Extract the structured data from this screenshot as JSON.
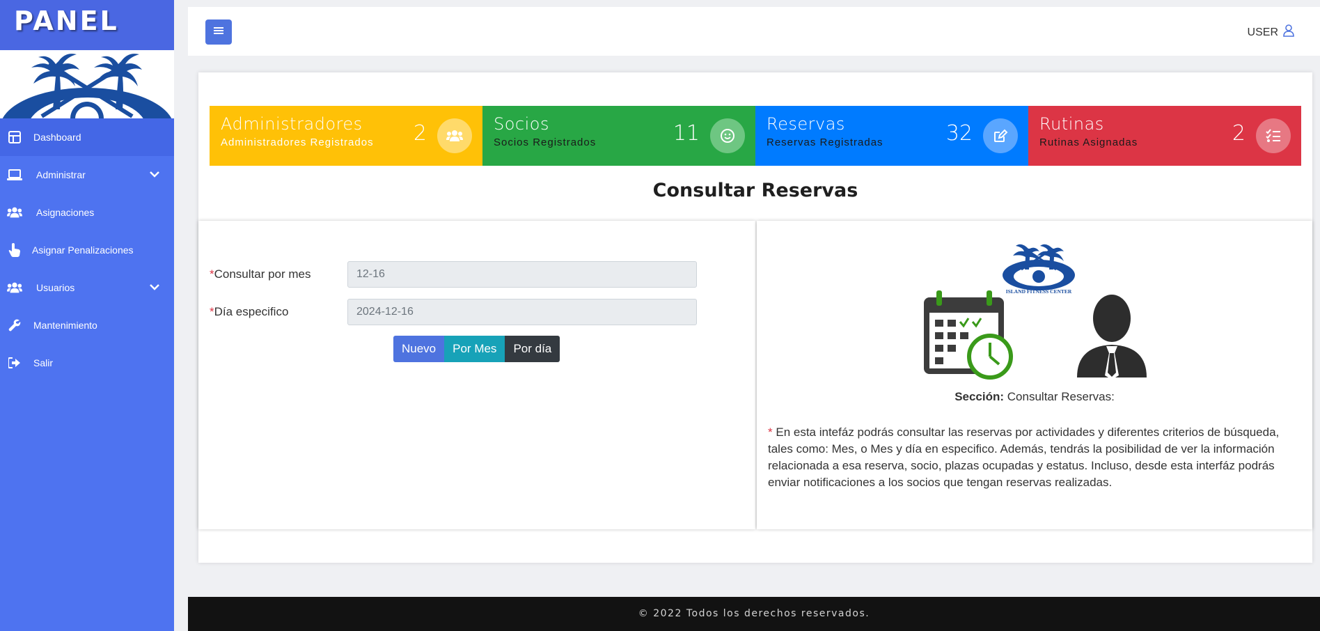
{
  "brand": {
    "title": "PANEL"
  },
  "sidebar": {
    "items": [
      {
        "label": "Dashboard",
        "icon": "dashboard-icon"
      },
      {
        "label": "Administrar",
        "icon": "laptop-icon"
      },
      {
        "label": "Asignaciones",
        "icon": "users-icon"
      },
      {
        "label": "Asignar Penalizaciones",
        "icon": "hand-pointer-icon"
      },
      {
        "label": "Usuarios",
        "icon": "users-icon"
      },
      {
        "label": "Mantenimiento",
        "icon": "wrench-icon"
      },
      {
        "label": "Salir",
        "icon": "sign-out-icon"
      }
    ]
  },
  "topbar": {
    "user_label": "USER"
  },
  "stats": [
    {
      "title": "Administradores",
      "subtitle": "Administradores Registrados",
      "count": "2",
      "color": "#ffc107",
      "icon": "users-icon"
    },
    {
      "title": "Socios",
      "subtitle": "Socios Registrados",
      "count": "11",
      "color": "#28a745",
      "icon": "smile-icon"
    },
    {
      "title": "Reservas",
      "subtitle": "Reservas Registradas",
      "count": "32",
      "color": "#007bff",
      "icon": "edit-icon"
    },
    {
      "title": "Rutinas",
      "subtitle": "Rutinas Asignadas",
      "count": "2",
      "color": "#dc3545",
      "icon": "list-check-icon"
    }
  ],
  "page_title": "Consultar Reservas",
  "form": {
    "month_label": "Consultar por mes",
    "month_value": "12-16",
    "day_label": "Día especifico",
    "day_value": "2024-12-16",
    "required_mark": "*",
    "buttons": {
      "nuevo": "Nuevo",
      "por_mes": "Por Mes",
      "por_dia": "Por día"
    }
  },
  "info": {
    "logo_text": "ISLAND FITNESS CENTER",
    "section_label": "Sección:",
    "section_value": "Consultar Reservas:",
    "bullet": "*",
    "description": "En esta intefáz podrás consultar las reservas por actividades y diferentes criterios de búsqueda, tales como: Mes, o Mes y día en especifico. Además, tendrás la posibilidad de ver la información relacionada a esa reserva, socio, plazas ocupadas y estatus. Incluso, desde esta interfáz podrás enviar notificaciones a los socios que tengan reservas realizadas."
  },
  "footer": {
    "text": "© 2022 Todos los derechos reservados."
  }
}
